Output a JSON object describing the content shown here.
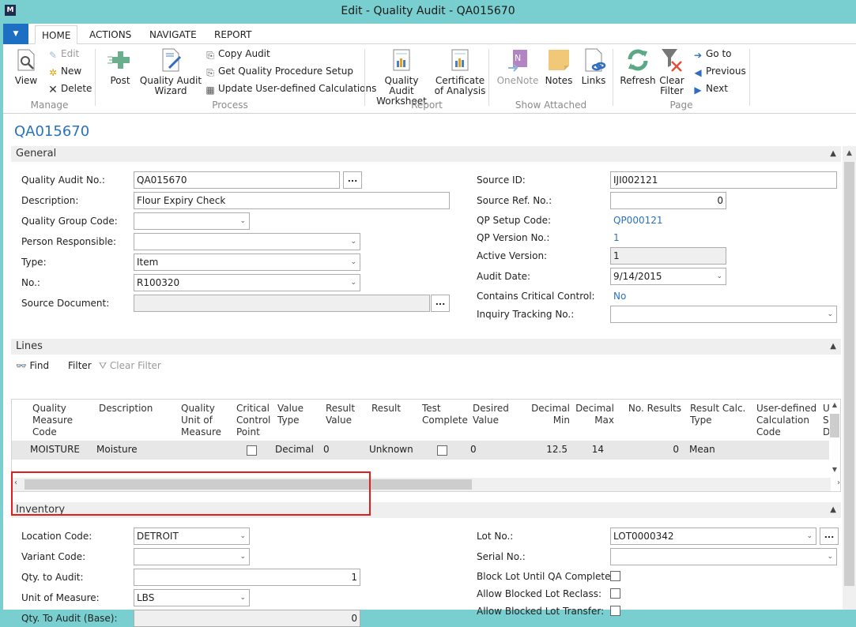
{
  "window": {
    "title": "Edit - Quality Audit - QA015670",
    "logo": "logo-icon"
  },
  "ribbon": {
    "tabs": [
      {
        "label": "HOME",
        "active": true
      },
      {
        "label": "ACTIONS"
      },
      {
        "label": "NAVIGATE"
      },
      {
        "label": "REPORT"
      }
    ],
    "groups": {
      "manage": {
        "label": "Manage",
        "view": "View",
        "edit": "Edit",
        "new": "New",
        "delete": "Delete"
      },
      "process": {
        "label": "Process",
        "post": "Post",
        "wizard_line1": "Quality Audit",
        "wizard_line2": "Wizard",
        "copy_audit": "Copy Audit",
        "get_setup": "Get Quality Procedure Setup",
        "update_calc": "Update User-defined Calculations"
      },
      "report": {
        "label": "Report",
        "worksheet_line1": "Quality Audit",
        "worksheet_line2": "Worksheet",
        "coa_line1": "Certificate",
        "coa_line2": "of Analysis"
      },
      "show_attached": {
        "label": "Show Attached",
        "onenote": "OneNote",
        "notes": "Notes",
        "links": "Links"
      },
      "page": {
        "label": "Page",
        "refresh": "Refresh",
        "clear_line1": "Clear",
        "clear_line2": "Filter",
        "goto": "Go to",
        "previous": "Previous",
        "next": "Next"
      }
    }
  },
  "page": {
    "title": "QA015670"
  },
  "general": {
    "header": "General",
    "quality_audit_no": {
      "label": "Quality Audit No.:",
      "value": "QA015670"
    },
    "description": {
      "label": "Description:",
      "value": "Flour Expiry Check"
    },
    "quality_group_code": {
      "label": "Quality Group Code:",
      "value": ""
    },
    "person_responsible": {
      "label": "Person Responsible:",
      "value": ""
    },
    "type": {
      "label": "Type:",
      "value": "Item"
    },
    "no": {
      "label": "No.:",
      "value": "R100320"
    },
    "source_document": {
      "label": "Source Document:",
      "value": ""
    },
    "source_id": {
      "label": "Source ID:",
      "value": "IJI002121"
    },
    "source_ref_no": {
      "label": "Source Ref. No.:",
      "value": "0"
    },
    "qp_setup_code": {
      "label": "QP Setup Code:",
      "value": "QP000121"
    },
    "qp_version_no": {
      "label": "QP Version No.:",
      "value": "1"
    },
    "active_version": {
      "label": "Active Version:",
      "value": "1"
    },
    "audit_date": {
      "label": "Audit Date:",
      "value": "9/14/2015"
    },
    "contains_critical_control": {
      "label": "Contains Critical Control:",
      "value": "No"
    },
    "inquiry_tracking_no": {
      "label": "Inquiry Tracking No.:",
      "value": ""
    }
  },
  "lines": {
    "header": "Lines",
    "toolbar": {
      "find": "Find",
      "filter": "Filter",
      "clear_filter": "Clear Filter"
    },
    "columns": [
      "Quality\nMeasure\nCode",
      "Description",
      "Quality\nUnit of\nMeasure",
      "Critical\nControl\nPoint",
      "Value\nType",
      "Result\nValue",
      "Result",
      "Test\nComplete",
      "Desired\nValue",
      "Decimal\nMin",
      "Decimal\nMax",
      "No. Results",
      "Result Calc.\nType",
      "User-defined\nCalculation\nCode",
      "Up\nSn\nDe"
    ],
    "rows": [
      {
        "code": "MOISTURE",
        "description": "Moisture",
        "unit": "",
        "critical": false,
        "value_type": "Decimal",
        "result_value": "0",
        "result": "Unknown",
        "test_complete": false,
        "desired_value": "0",
        "decimal_min": "12.5",
        "decimal_max": "14",
        "no_results": "0",
        "calc_type": "Mean",
        "udc_code": ""
      }
    ]
  },
  "inventory": {
    "header": "Inventory",
    "location_code": {
      "label": "Location Code:",
      "value": "DETROIT"
    },
    "variant_code": {
      "label": "Variant Code:",
      "value": ""
    },
    "qty_to_audit": {
      "label": "Qty. to Audit:",
      "value": "1"
    },
    "unit_of_measure": {
      "label": "Unit of Measure:",
      "value": "LBS"
    },
    "qty_to_audit_base": {
      "label": "Qty. To Audit (Base):",
      "value": "0"
    },
    "lot_no": {
      "label": "Lot No.:",
      "value": "LOT0000342"
    },
    "serial_no": {
      "label": "Serial No.:",
      "value": ""
    },
    "block_lot": {
      "label": "Block Lot Until QA Complete:",
      "checked": false
    },
    "allow_reclass": {
      "label": "Allow Blocked Lot Reclass:",
      "checked": false
    },
    "allow_transfer": {
      "label": "Allow Blocked Lot Transfer:",
      "checked": false
    }
  },
  "colors": {
    "accent": "#2872c0",
    "titlebar": "#79cfcf",
    "highlight_box": "#e11d1d"
  }
}
